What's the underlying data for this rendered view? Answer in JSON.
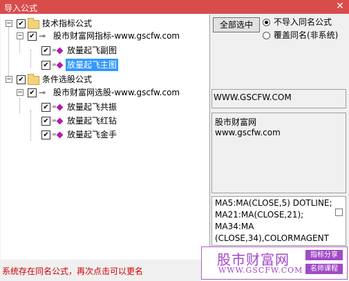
{
  "window": {
    "title": "导入公式",
    "close_glyph": "✕"
  },
  "tree": {
    "groups": [
      {
        "label": "技术指标公式",
        "sub": {
          "label": "股市财富网指标-www.gscfw.com",
          "items": [
            "放量起飞副图",
            "放量起飞主图"
          ]
        }
      },
      {
        "label": "条件选股公式",
        "sub": {
          "label": "股市财富网选股-www.gscfw.com",
          "items": [
            "放量起飞共振",
            "放量起飞红钻",
            "放量起飞金手"
          ]
        }
      }
    ],
    "selected_item": "放量起飞主图"
  },
  "options": {
    "select_all_label": "全部选中",
    "radio_skip": "不导入同名公式",
    "radio_overwrite": "覆盖同名(非系统)"
  },
  "info": {
    "url_box": "WWW.GSCFW.COM",
    "desc_line1": "股市财富网",
    "desc_line2": "www.gscfw.com",
    "code_lines": [
      "MA5:MA(CLOSE,5) DOTLINE;",
      "MA21:MA(CLOSE,21);",
      "MA34:MA",
      "(CLOSE,34),COLORMAGENT"
    ]
  },
  "status": "系统存在同名公式，再次点击可以更名",
  "watermark": {
    "title": "股市财富网",
    "url": "WWW.GSCFW.COM",
    "tag1": "指标分享",
    "tag2": "名师课程"
  },
  "colors": {
    "titlebar": "#d94c4c",
    "selection": "#3399ff",
    "status": "#d00000",
    "watermark": "#a546c8"
  }
}
